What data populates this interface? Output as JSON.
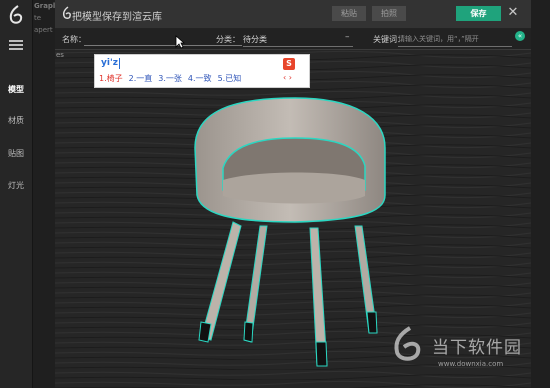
{
  "app": {
    "sidebar_items": [
      {
        "label": "模型",
        "active": true
      },
      {
        "label": "材质",
        "active": false
      },
      {
        "label": "贴图",
        "active": false
      },
      {
        "label": "灯光",
        "active": false
      }
    ],
    "bg_text_top": "Grapl",
    "bg_text_mid": "te",
    "bg_text_low": "apert"
  },
  "dialog": {
    "title": "把模型保存到渲云库",
    "buttons": {
      "paste": "粘贴",
      "screenshot": "拍照",
      "save": "保存"
    },
    "form": {
      "name_label": "名称：",
      "name_value": "",
      "category_label": "分类：",
      "category_value": "待分类",
      "keywords_label": "关键词：",
      "keywords_placeholder": "请输入关键词，用“，”隔开"
    },
    "viewport_label": "es"
  },
  "ime": {
    "input": "yi'z",
    "candidates": [
      "1.椅子",
      "2.一直",
      "3.一张",
      "4.一致",
      "5.已知"
    ]
  },
  "watermark": {
    "text": "当下软件园",
    "url": "www.downxia.com"
  },
  "colors": {
    "accent": "#1fa37c",
    "outline": "#2bd7c2",
    "background": "#1f1f1f"
  }
}
